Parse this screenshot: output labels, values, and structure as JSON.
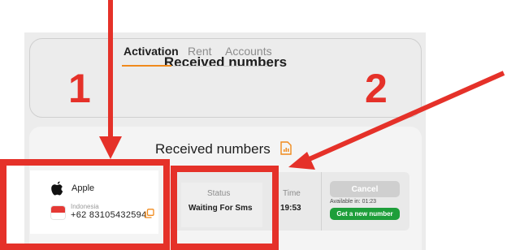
{
  "header": {
    "title": "Received numbers",
    "tabs": [
      {
        "label": "Activation",
        "active": true
      },
      {
        "label": "Rent",
        "active": false
      },
      {
        "label": "Accounts",
        "active": false
      }
    ]
  },
  "main": {
    "title": "Received numbers",
    "title_icon": "document-chart-icon",
    "row": {
      "service": {
        "icon": "apple-icon",
        "name": "Apple"
      },
      "country": {
        "flag": "indonesia-flag-icon",
        "name": "Indonesia"
      },
      "phone": "+62 83105432594",
      "status_label": "Status",
      "status_value": "Waiting For Sms",
      "time_label": "Time",
      "time_value": "19:53",
      "cancel_label": "Cancel",
      "available_in": "Available in: 01:23",
      "new_number_label": "Get a new number"
    }
  },
  "annotations": {
    "number_1": "1",
    "number_2": "2",
    "color": "#e53129"
  },
  "colors": {
    "accent": "#f08a1c",
    "success": "#1e9e3a",
    "disabled": "#cfcfcf"
  }
}
